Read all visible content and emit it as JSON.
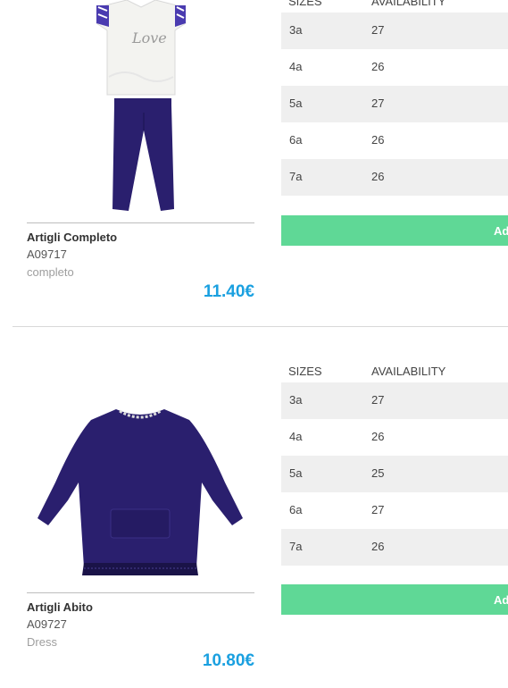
{
  "products": [
    {
      "name": "Artigli Completo",
      "code": "A09717",
      "category": "completo",
      "price": "11.40€",
      "table_header": {
        "sizes": "SIZES",
        "availability": "AVAILABILITY"
      },
      "rows": [
        {
          "size": "3a",
          "qty": "27"
        },
        {
          "size": "4a",
          "qty": "26"
        },
        {
          "size": "5a",
          "qty": "27"
        },
        {
          "size": "6a",
          "qty": "26"
        },
        {
          "size": "7a",
          "qty": "26"
        }
      ],
      "add_label": "Ad",
      "image_print_text": "Love"
    },
    {
      "name": "Artigli Abito",
      "code": "A09727",
      "category": "Dress",
      "price": "10.80€",
      "table_header": {
        "sizes": "SIZES",
        "availability": "AVAILABILITY"
      },
      "rows": [
        {
          "size": "3a",
          "qty": "27"
        },
        {
          "size": "4a",
          "qty": "26"
        },
        {
          "size": "5a",
          "qty": "25"
        },
        {
          "size": "6a",
          "qty": "27"
        },
        {
          "size": "7a",
          "qty": "26"
        }
      ],
      "add_label": "Ad"
    }
  ],
  "colors": {
    "price": "#1aa0e0",
    "add_button": "#5fd896",
    "row_alt": "#efefef",
    "navy": "#2a1f6e"
  }
}
